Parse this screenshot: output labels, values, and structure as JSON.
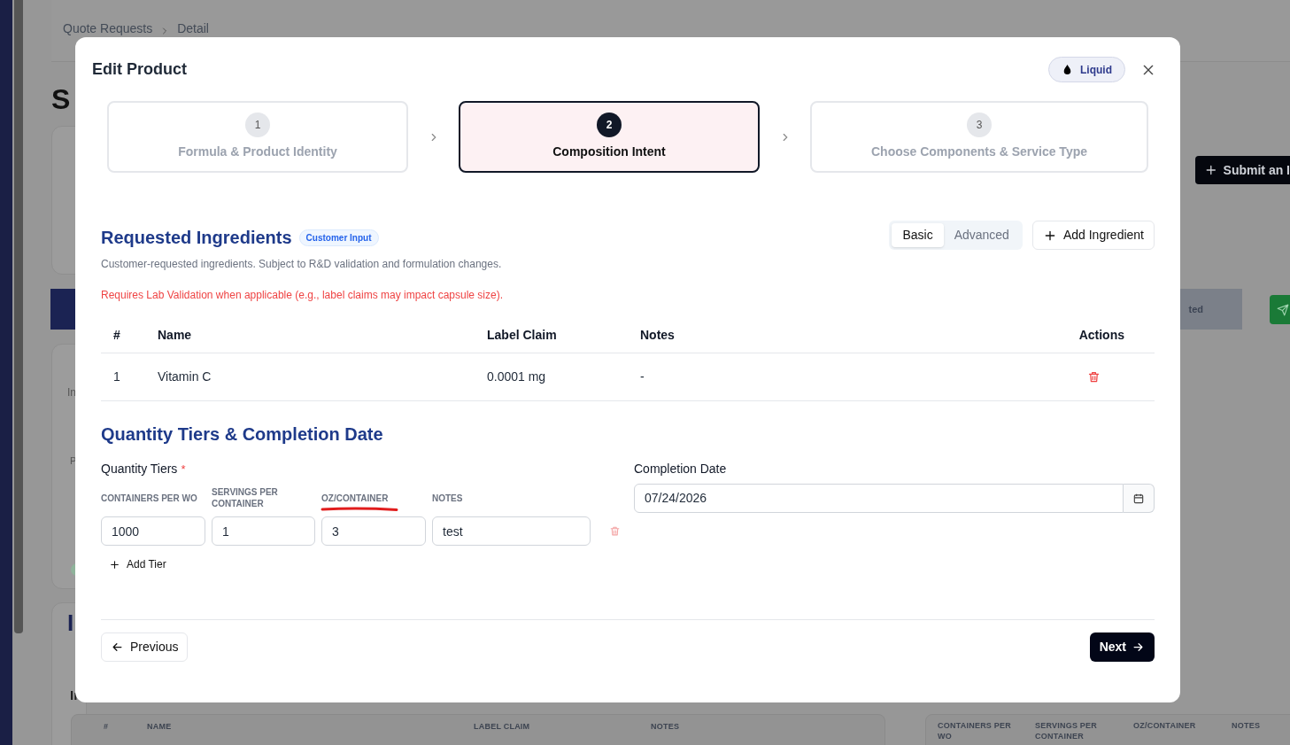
{
  "background": {
    "breadcrumb": [
      "Quote Requests",
      "Detail"
    ],
    "page_title": "S",
    "submit_button": "Submit an I",
    "status_button": "ted",
    "card_fragments": [
      {
        "text": "In",
        "kind": "sub"
      },
      {
        "text": "P",
        "kind": "small"
      },
      {
        "text": "I",
        "kind": "heading"
      },
      {
        "text": "Ir",
        "kind": "label"
      }
    ],
    "ingredients_table_columns": [
      "#",
      "NAME",
      "LABEL CLAIM",
      "NOTES"
    ],
    "tiers_table_columns": [
      "CONTAINERS PER WO",
      "SERVINGS PER CONTAINER",
      "OZ/CONTAINER",
      "NOTES"
    ]
  },
  "modal": {
    "title": "Edit Product",
    "badge": "Liquid",
    "steps": [
      {
        "number": "1",
        "label": "Formula & Product Identity",
        "selected": false
      },
      {
        "number": "2",
        "label": "Composition Intent",
        "selected": true
      },
      {
        "number": "3",
        "label": "Choose Components & Service Type",
        "selected": false
      }
    ],
    "ingredients": {
      "title": "Requested Ingredients",
      "tag": "Customer Input",
      "description": "Customer-requested ingredients. Subject to R&D validation and formulation changes.",
      "warning": "Requires Lab Validation when applicable (e.g., label claims may impact capsule size).",
      "view_toggle": [
        {
          "label": "Basic",
          "selected": true
        },
        {
          "label": "Advanced",
          "selected": false
        }
      ],
      "add_button": "Add Ingredient",
      "columns": [
        "#",
        "Name",
        "Label Claim",
        "Notes",
        "Actions"
      ],
      "rows": [
        {
          "index": "1",
          "name": "Vitamin C",
          "label_claim": "0.0001 mg",
          "notes": "-"
        }
      ]
    },
    "quantity": {
      "title": "Quantity Tiers & Completion Date",
      "tiers_label": "Quantity Tiers",
      "required": true,
      "required_mark": "*",
      "columns": [
        "CONTAINERS PER WO",
        "SERVINGS PER CONTAINER",
        "OZ/CONTAINER",
        "NOTES"
      ],
      "tiers": [
        {
          "values": [
            "1000",
            "1",
            "3",
            "test"
          ]
        }
      ],
      "add_tier": "Add Tier",
      "date_label": "Completion Date",
      "date_value": "07/24/2026"
    },
    "previous_button": "Previous",
    "next_button": "Next"
  }
}
